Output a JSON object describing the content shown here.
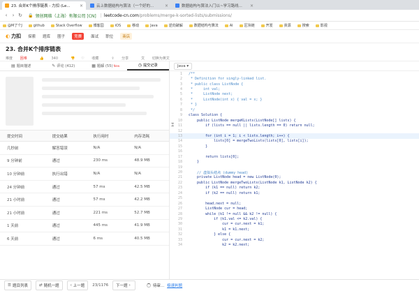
{
  "browser": {
    "tabs": [
      {
        "title": "23. 合并K个排序链表 - 力扣 (Le...",
        "color": "#f7a21b",
        "active": true
      },
      {
        "title": "云上数据结构与算法（一个好的...",
        "color": "#3b82f6",
        "active": false
      },
      {
        "title": "数据结构与算法入门以~学习路线...",
        "color": "#3b82f6",
        "active": false
      }
    ],
    "address": {
      "secure_label": "领创网络（上海）有限公司 [CN]",
      "domain": "leetcode-cn.com",
      "path": "/problems/merge-k-sorted-lists/submissions/"
    },
    "bookmarks": [
      "@M了个J",
      "github",
      "Stack Overflow",
      "博客园",
      "iOS",
      "移动",
      "Java",
      "逆向破解",
      "数据结构与算法",
      "AI",
      "区块链",
      "开发",
      "资源",
      "搜索",
      "影视"
    ]
  },
  "site": {
    "logo": "力扣",
    "nav": [
      "探索",
      "题库",
      "圈子",
      "竞赛",
      "面试",
      "职位",
      "商店"
    ],
    "contest_index": 3,
    "vip_index": 6
  },
  "problem": {
    "title": "23. 合并K个排序链表",
    "difficulty_label": "难度",
    "difficulty": "困难",
    "likes": "340",
    "collect": "收藏",
    "share": "分享",
    "switch_lang": "切换为英文"
  },
  "left_tabs": [
    {
      "icon": "▤",
      "label": "题目描述"
    },
    {
      "icon": "✎",
      "label": "评论 (412)"
    },
    {
      "icon": "▦",
      "label": "题解 (55)",
      "badge": "New"
    },
    {
      "icon": "◷",
      "label": "提交记录",
      "active": true
    }
  ],
  "table": {
    "headers": [
      "提交时间",
      "提交结果",
      "执行用时",
      "内存消耗"
    ],
    "rows": [
      [
        "几秒前",
        "解答错误",
        "N/A",
        "N/A"
      ],
      [
        "9 分钟前",
        "通过",
        "230 ms",
        "48.9 MB"
      ],
      [
        "10 分钟前",
        "执行出错",
        "N/A",
        "N/A"
      ],
      [
        "24 分钟前",
        "通过",
        "57 ms",
        "42.5 MB"
      ],
      [
        "21 小时前",
        "通过",
        "57 ms",
        "42.2 MB"
      ],
      [
        "21 小时前",
        "通过",
        "221 ms",
        "52.7 MB"
      ],
      [
        "1 天前",
        "通过",
        "445 ms",
        "41.9 MB"
      ],
      [
        "6 天前",
        "通过",
        "6 ms",
        "40.5 MB"
      ]
    ]
  },
  "editor": {
    "language": "Java",
    "lines": [
      {
        "n": "1",
        "t": "/**",
        "c": true
      },
      {
        "n": "2",
        "t": " * Definition for singly-linked list.",
        "c": true
      },
      {
        "n": "3",
        "t": " * public class ListNode {",
        "c": true
      },
      {
        "n": "4",
        "t": " *     int val;",
        "c": true
      },
      {
        "n": "5",
        "t": " *     ListNode next;",
        "c": true
      },
      {
        "n": "6",
        "t": " *     ListNode(int x) { val = x; }",
        "c": true
      },
      {
        "n": "7",
        "t": " * }",
        "c": true
      },
      {
        "n": "8",
        "t": " */",
        "c": true
      },
      {
        "n": "9",
        "t": "class Solution {"
      },
      {
        "n": "10",
        "t": "    public ListNode mergeKLists(ListNode[] lists) {"
      },
      {
        "n": "11",
        "t": "        if (lists == null || lists.length == 0) return null;"
      },
      {
        "n": "12",
        "t": ""
      },
      {
        "n": "13",
        "t": "        for (int i = 1; i < lists.length; i++) {",
        "h": true
      },
      {
        "n": "14",
        "t": "            lists[0] = mergeTwoLists(lists[0], lists[i]);"
      },
      {
        "n": "15",
        "t": "        }"
      },
      {
        "n": "16",
        "t": ""
      },
      {
        "n": "17",
        "t": "        return lists[0];"
      },
      {
        "n": "18",
        "t": "    }"
      },
      {
        "n": "19",
        "t": ""
      },
      {
        "n": "20",
        "t": "    // 虚拟头结点 (dummy head)",
        "c": true
      },
      {
        "n": "21",
        "t": "    private ListNode head = new ListNode(0);"
      },
      {
        "n": "22",
        "t": "    public ListNode mergeTwoLists(ListNode k1, ListNode k2) {"
      },
      {
        "n": "23",
        "t": "        if (k1 == null) return k2;"
      },
      {
        "n": "24",
        "t": "        if (k2 == null) return k1;"
      },
      {
        "n": "25",
        "t": ""
      },
      {
        "n": "26",
        "t": "        head.next = null;"
      },
      {
        "n": "27",
        "t": "        ListNode cur = head;"
      },
      {
        "n": "28",
        "t": "        while (k1 != null && k2 != null) {"
      },
      {
        "n": "29",
        "t": "            if (k1.val <= k2.val) {"
      },
      {
        "n": "30",
        "t": "                cur = cur.next = k1;"
      },
      {
        "n": "31",
        "t": "                k1 = k1.next;"
      },
      {
        "n": "32",
        "t": "            } else {"
      },
      {
        "n": "33",
        "t": "                cur = cur.next = k2;"
      },
      {
        "n": "34",
        "t": "                k2 = k2.next;"
      }
    ]
  },
  "bottom": {
    "problem_list": "题目列表",
    "random": "随机一题",
    "prev": "上一题",
    "page": "23/1176",
    "next": "下一题",
    "status": "待审...",
    "link": "极速判题"
  }
}
